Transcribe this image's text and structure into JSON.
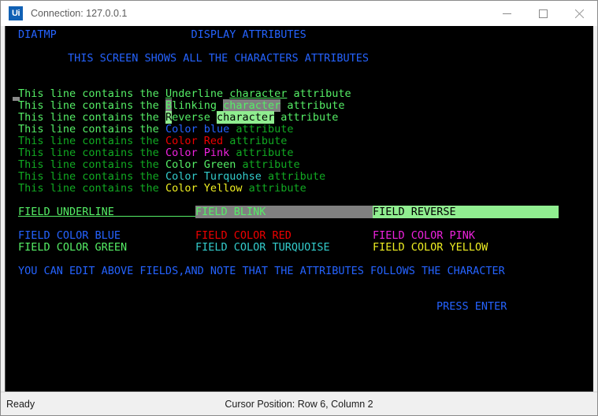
{
  "window": {
    "app_icon_label": "Ui",
    "title": "Connection: 127.0.0.1",
    "controls": {
      "minimize": "minimize-button",
      "maximize": "maximize-button",
      "close": "close-button"
    }
  },
  "palette": {
    "background": "#000000",
    "blue": "#2563ff",
    "bright_green": "#55ee66",
    "dark_green": "#11aa22",
    "red": "#ee0000",
    "pink": "#ee22dd",
    "turquoise": "#33cccc",
    "yellow": "#eeee22",
    "gray_bg": "#808080",
    "light_green_bg": "#90ee90",
    "white": "#ffffff"
  },
  "terminal": {
    "header": {
      "program_id": "DIATMP",
      "screen_title": "DISPLAY ATTRIBUTES",
      "subtitle": "THIS SCREEN SHOWS ALL THE CHARACTERS ATTRIBUTES"
    },
    "character_attribute_lines": [
      {
        "id": "underline-line",
        "segments": [
          {
            "text": "This line contains the ",
            "color": "bright_green",
            "underline": false,
            "bg": ""
          },
          {
            "text": "U",
            "color": "bright_green",
            "underline": true,
            "bg": ""
          },
          {
            "text": "nderline ",
            "color": "bright_green",
            "underline": false,
            "bg": ""
          },
          {
            "text": "character",
            "color": "bright_green",
            "underline": true,
            "bg": ""
          },
          {
            "text": " attribute",
            "color": "bright_green",
            "underline": false,
            "bg": ""
          }
        ]
      },
      {
        "id": "blinking-line",
        "segments": [
          {
            "text": "This line contains the ",
            "color": "bright_green",
            "underline": false,
            "bg": ""
          },
          {
            "text": "B",
            "color": "bright_green",
            "underline": false,
            "bg": "gray_bg"
          },
          {
            "text": "linking ",
            "color": "bright_green",
            "underline": false,
            "bg": ""
          },
          {
            "text": "character",
            "color": "bright_green",
            "underline": false,
            "bg": "gray_bg"
          },
          {
            "text": " attribute",
            "color": "bright_green",
            "underline": false,
            "bg": ""
          }
        ]
      },
      {
        "id": "reverse-line",
        "segments": [
          {
            "text": "This line contains the ",
            "color": "bright_green",
            "underline": false,
            "bg": ""
          },
          {
            "text": "R",
            "color": "background",
            "underline": false,
            "bg": "light_green_bg"
          },
          {
            "text": "everse ",
            "color": "bright_green",
            "underline": false,
            "bg": ""
          },
          {
            "text": "character",
            "color": "background",
            "underline": false,
            "bg": "light_green_bg"
          },
          {
            "text": " attribute",
            "color": "bright_green",
            "underline": false,
            "bg": ""
          }
        ]
      },
      {
        "id": "color-blue-line",
        "segments": [
          {
            "text": "This line contains the ",
            "color": "bright_green",
            "underline": false,
            "bg": ""
          },
          {
            "text": "Color ",
            "color": "blue",
            "underline": false,
            "bg": ""
          },
          {
            "text": "blue",
            "color": "blue",
            "underline": false,
            "bg": ""
          },
          {
            "text": " attribute",
            "color": "dark_green",
            "underline": false,
            "bg": ""
          }
        ]
      },
      {
        "id": "color-red-line",
        "segments": [
          {
            "text": "This line contains the ",
            "color": "dark_green",
            "underline": false,
            "bg": ""
          },
          {
            "text": "Color ",
            "color": "red",
            "underline": false,
            "bg": ""
          },
          {
            "text": "Red",
            "color": "red",
            "underline": false,
            "bg": ""
          },
          {
            "text": " attribute",
            "color": "dark_green",
            "underline": false,
            "bg": ""
          }
        ]
      },
      {
        "id": "color-pink-line",
        "segments": [
          {
            "text": "This line contains the ",
            "color": "dark_green",
            "underline": false,
            "bg": ""
          },
          {
            "text": "Color ",
            "color": "pink",
            "underline": false,
            "bg": ""
          },
          {
            "text": "Pink",
            "color": "pink",
            "underline": false,
            "bg": ""
          },
          {
            "text": " attribute",
            "color": "dark_green",
            "underline": false,
            "bg": ""
          }
        ]
      },
      {
        "id": "color-green-line",
        "segments": [
          {
            "text": "This line contains the ",
            "color": "dark_green",
            "underline": false,
            "bg": ""
          },
          {
            "text": "Color ",
            "color": "bright_green",
            "underline": false,
            "bg": ""
          },
          {
            "text": "Green",
            "color": "bright_green",
            "underline": false,
            "bg": ""
          },
          {
            "text": " attribute",
            "color": "dark_green",
            "underline": false,
            "bg": ""
          }
        ]
      },
      {
        "id": "color-turquoise-line",
        "segments": [
          {
            "text": "This line contains the ",
            "color": "dark_green",
            "underline": false,
            "bg": ""
          },
          {
            "text": "Color ",
            "color": "turquoise",
            "underline": false,
            "bg": ""
          },
          {
            "text": "Turquohse",
            "color": "turquoise",
            "underline": false,
            "bg": ""
          },
          {
            "text": " attribute",
            "color": "dark_green",
            "underline": false,
            "bg": ""
          }
        ]
      },
      {
        "id": "color-yellow-line",
        "segments": [
          {
            "text": "This line contains the ",
            "color": "dark_green",
            "underline": false,
            "bg": ""
          },
          {
            "text": "Color ",
            "color": "yellow",
            "underline": false,
            "bg": ""
          },
          {
            "text": "Yellow",
            "color": "yellow",
            "underline": false,
            "bg": ""
          },
          {
            "text": " attribute",
            "color": "dark_green",
            "underline": false,
            "bg": ""
          }
        ]
      }
    ],
    "attribute_fields": [
      {
        "id": "field-underline",
        "value": "FIELD UNDERLINE",
        "width_chars": 28,
        "color": "bright_green",
        "bg": "",
        "underline": true
      },
      {
        "id": "field-blink",
        "value": "FIELD BLINK",
        "width_chars": 29,
        "color": "bright_green",
        "bg": "gray_bg",
        "underline": false
      },
      {
        "id": "field-reverse",
        "value": "FIELD REVERSE",
        "width_chars": 29,
        "color": "background",
        "bg": "light_green_bg",
        "underline": false
      }
    ],
    "color_fields_row1": [
      {
        "id": "field-color-blue",
        "value": "FIELD COLOR BLUE",
        "color": "blue"
      },
      {
        "id": "field-color-red",
        "value": "FIELD COLOR RED",
        "color": "red"
      },
      {
        "id": "field-color-pink",
        "value": "FIELD COLOR PINK",
        "color": "pink"
      }
    ],
    "color_fields_row2": [
      {
        "id": "field-color-green",
        "value": "FIELD COLOR GREEN",
        "color": "bright_green"
      },
      {
        "id": "field-color-turquoise",
        "value": "FIELD COLOR TURQUOISE",
        "color": "turquoise"
      },
      {
        "id": "field-color-yellow",
        "value": "FIELD COLOR YELLOW",
        "color": "yellow"
      }
    ],
    "instruction": "YOU CAN EDIT ABOVE FIELDS,AND NOTE THAT THE ATTRIBUTES FOLLOWS THE CHARACTER",
    "prompt": "PRESS ENTER"
  },
  "status_bar": {
    "state": "Ready",
    "cursor_position": "Cursor Position: Row 6, Column 2"
  }
}
